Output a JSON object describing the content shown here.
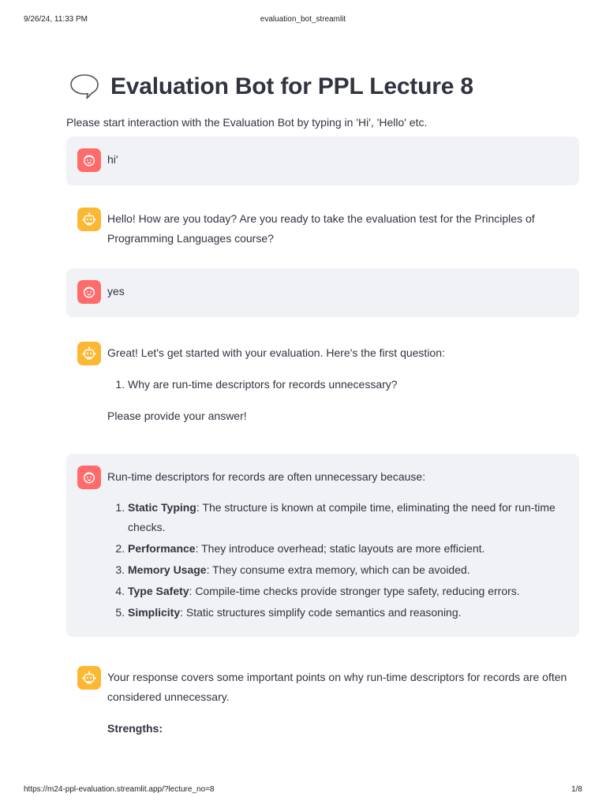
{
  "print_header": {
    "date": "9/26/24, 11:33 PM",
    "title": "evaluation_bot_streamlit"
  },
  "print_footer": {
    "url": "https://m24-ppl-evaluation.streamlit.app/?lecture_no=8",
    "page": "1/8"
  },
  "page": {
    "title_icon": "speech-balloon-icon",
    "title": "Evaluation Bot for PPL Lecture 8",
    "intro": "Please start interaction with the Evaluation Bot by typing in 'Hi', 'Hello' etc."
  },
  "colors": {
    "user_bubble_bg": "#f0f2f6",
    "user_avatar": "#ff6b6b",
    "bot_avatar": "#fdb833",
    "text": "#31333f"
  },
  "messages": [
    {
      "role": "user",
      "avatar_icon": "user-face-icon",
      "text": "hi'"
    },
    {
      "role": "assistant",
      "avatar_icon": "robot-icon",
      "text": "Hello! How are you today? Are you ready to take the evaluation test for the Principles of Programming Languages course?"
    },
    {
      "role": "user",
      "avatar_icon": "user-face-icon",
      "text": "yes"
    },
    {
      "role": "assistant",
      "avatar_icon": "robot-icon",
      "text": "Great! Let's get started with your evaluation. Here's the first question:",
      "list": [
        {
          "text": "Why are run-time descriptors for records unnecessary?"
        }
      ],
      "after": "Please provide your answer!"
    },
    {
      "role": "user",
      "avatar_icon": "user-face-icon",
      "text": "Run-time descriptors for records are often unnecessary because:",
      "list": [
        {
          "term": "Static Typing",
          "text": ": The structure is known at compile time, eliminating the need for run-time checks."
        },
        {
          "term": "Performance",
          "text": ": They introduce overhead; static layouts are more efficient."
        },
        {
          "term": "Memory Usage",
          "text": ": They consume extra memory, which can be avoided."
        },
        {
          "term": "Type Safety",
          "text": ": Compile-time checks provide stronger type safety, reducing errors."
        },
        {
          "term": "Simplicity",
          "text": ": Static structures simplify code semantics and reasoning."
        }
      ]
    },
    {
      "role": "assistant",
      "avatar_icon": "robot-icon",
      "text": "Your response covers some important points on why run-time descriptors for records are often considered unnecessary.",
      "after": "Strengths:"
    }
  ]
}
